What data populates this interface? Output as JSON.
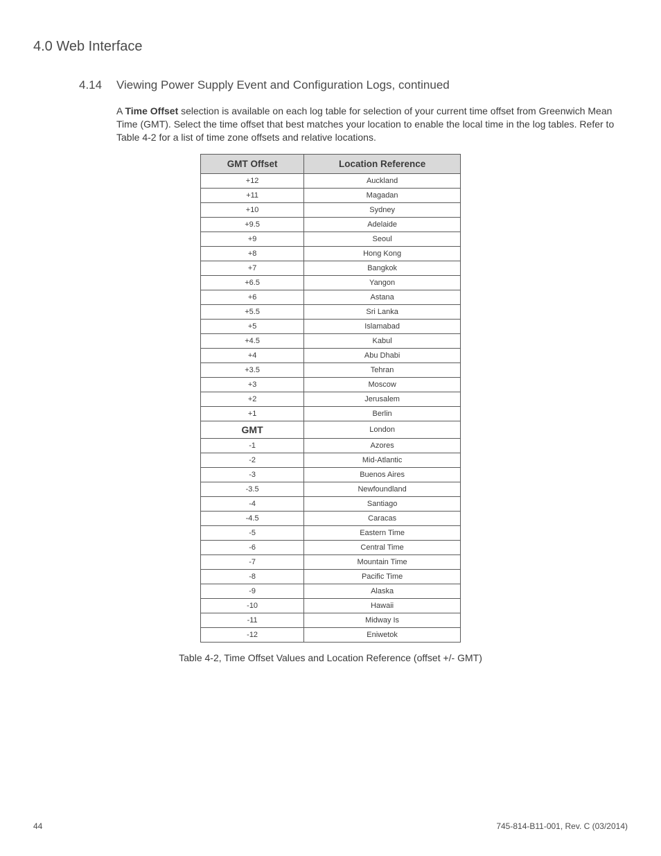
{
  "header": {
    "title": "4.0 Web Interface"
  },
  "section": {
    "number": "4.14",
    "title": "Viewing Power Supply Event and Configuration Logs, continued"
  },
  "paragraph": {
    "lead_a": "A ",
    "bold": "Time Offset",
    "rest": " selection is available on each log table for selection of your current time offset from Greenwich Mean Time (GMT). Select the time offset that best matches your location to enable the local time in the log tables. Refer to Table 4-2 for a list of time zone offsets and relative locations."
  },
  "table": {
    "headers": {
      "col1": "GMT Offset",
      "col2": "Location Reference"
    },
    "rows": [
      {
        "offset": "+12",
        "location": "Auckland",
        "is_gmt": false
      },
      {
        "offset": "+11",
        "location": "Magadan",
        "is_gmt": false
      },
      {
        "offset": "+10",
        "location": "Sydney",
        "is_gmt": false
      },
      {
        "offset": "+9.5",
        "location": "Adelaide",
        "is_gmt": false
      },
      {
        "offset": "+9",
        "location": "Seoul",
        "is_gmt": false
      },
      {
        "offset": "+8",
        "location": "Hong Kong",
        "is_gmt": false
      },
      {
        "offset": "+7",
        "location": "Bangkok",
        "is_gmt": false
      },
      {
        "offset": "+6.5",
        "location": "Yangon",
        "is_gmt": false
      },
      {
        "offset": "+6",
        "location": "Astana",
        "is_gmt": false
      },
      {
        "offset": "+5.5",
        "location": "Sri Lanka",
        "is_gmt": false
      },
      {
        "offset": "+5",
        "location": "Islamabad",
        "is_gmt": false
      },
      {
        "offset": "+4.5",
        "location": "Kabul",
        "is_gmt": false
      },
      {
        "offset": "+4",
        "location": "Abu Dhabi",
        "is_gmt": false
      },
      {
        "offset": "+3.5",
        "location": "Tehran",
        "is_gmt": false
      },
      {
        "offset": "+3",
        "location": "Moscow",
        "is_gmt": false
      },
      {
        "offset": "+2",
        "location": "Jerusalem",
        "is_gmt": false
      },
      {
        "offset": "+1",
        "location": "Berlin",
        "is_gmt": false
      },
      {
        "offset": "GMT",
        "location": "London",
        "is_gmt": true
      },
      {
        "offset": "-1",
        "location": "Azores",
        "is_gmt": false
      },
      {
        "offset": "-2",
        "location": "Mid-Atlantic",
        "is_gmt": false
      },
      {
        "offset": "-3",
        "location": "Buenos Aires",
        "is_gmt": false
      },
      {
        "offset": "-3.5",
        "location": "Newfoundland",
        "is_gmt": false
      },
      {
        "offset": "-4",
        "location": "Santiago",
        "is_gmt": false
      },
      {
        "offset": "-4.5",
        "location": "Caracas",
        "is_gmt": false
      },
      {
        "offset": "-5",
        "location": "Eastern Time",
        "is_gmt": false
      },
      {
        "offset": "-6",
        "location": "Central Time",
        "is_gmt": false
      },
      {
        "offset": "-7",
        "location": "Mountain Time",
        "is_gmt": false
      },
      {
        "offset": "-8",
        "location": "Pacific Time",
        "is_gmt": false
      },
      {
        "offset": "-9",
        "location": "Alaska",
        "is_gmt": false
      },
      {
        "offset": "-10",
        "location": "Hawaii",
        "is_gmt": false
      },
      {
        "offset": "-11",
        "location": "Midway Is",
        "is_gmt": false
      },
      {
        "offset": "-12",
        "location": "Eniwetok",
        "is_gmt": false
      }
    ],
    "caption": "Table 4-2, Time Offset Values and Location Reference (offset +/- GMT)"
  },
  "footer": {
    "page_number": "44",
    "doc_id": "745-814-B11-001, Rev. C (03/2014)"
  }
}
